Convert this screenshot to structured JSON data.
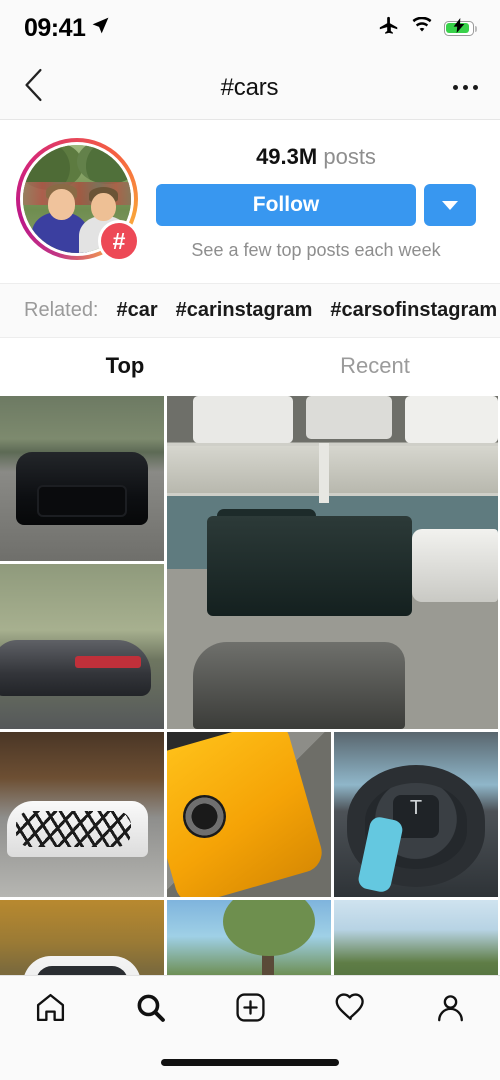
{
  "status_bar": {
    "time": "09:41",
    "location_icon": "location-arrow-icon",
    "airplane_icon": "airplane-mode-icon",
    "wifi_icon": "wifi-icon",
    "battery_icon": "battery-charging-icon",
    "battery_color": "#38d24a"
  },
  "header": {
    "back_icon": "back-chevron-icon",
    "title": "#cars",
    "more_icon": "more-options-icon"
  },
  "profile": {
    "avatar_badge": "#",
    "posts_count": "49.3M",
    "posts_label": "posts",
    "follow_label": "Follow",
    "follow_color": "#3897f0",
    "dropdown_icon": "chevron-down-icon",
    "note": "See a few top posts each week"
  },
  "related": {
    "label": "Related:",
    "tags": [
      "#car",
      "#carinstagram",
      "#carsofinstagram",
      "#"
    ]
  },
  "tabs": [
    {
      "label": "Top",
      "active": true
    },
    {
      "label": "Recent",
      "active": false
    }
  ],
  "grid": {
    "posts": [
      {
        "name": "post-black-bmw",
        "alt": "Black BMW sedan front view on cobblestone driveway",
        "art": "t-bmw"
      },
      {
        "name": "post-parking-lot-video",
        "alt": "Overhead view of parking lot with black pickup truck and cars",
        "art": "t-lot",
        "featured": true
      },
      {
        "name": "post-grey-audi",
        "alt": "Grey Audi coupe rear view with quad exhaust",
        "art": "t-audi"
      },
      {
        "name": "post-camo-sportscar",
        "alt": "White camouflage wrapped sports car on road",
        "art": "t-camo"
      },
      {
        "name": "post-yellow-car",
        "alt": "Yellow sports car front three quarter view",
        "art": "t-yel"
      },
      {
        "name": "post-tesla-wheel",
        "alt": "Tesla steering wheel interior",
        "art": "t-tes"
      },
      {
        "name": "post-white-car-autumn",
        "alt": "White car on autumn leaves",
        "art": "t-wht"
      },
      {
        "name": "post-dark-car-trees",
        "alt": "Dark car parked under trees",
        "art": "t-dark"
      },
      {
        "name": "post-red-car",
        "alt": "Red car on a wooded road",
        "art": "t-red"
      }
    ]
  },
  "bottom_nav": [
    {
      "name": "nav-home",
      "icon": "home-icon",
      "active": false
    },
    {
      "name": "nav-search",
      "icon": "search-icon",
      "active": true
    },
    {
      "name": "nav-create",
      "icon": "add-post-icon",
      "active": false
    },
    {
      "name": "nav-activity",
      "icon": "heart-icon",
      "active": false
    },
    {
      "name": "nav-profile",
      "icon": "person-icon",
      "active": false
    }
  ]
}
